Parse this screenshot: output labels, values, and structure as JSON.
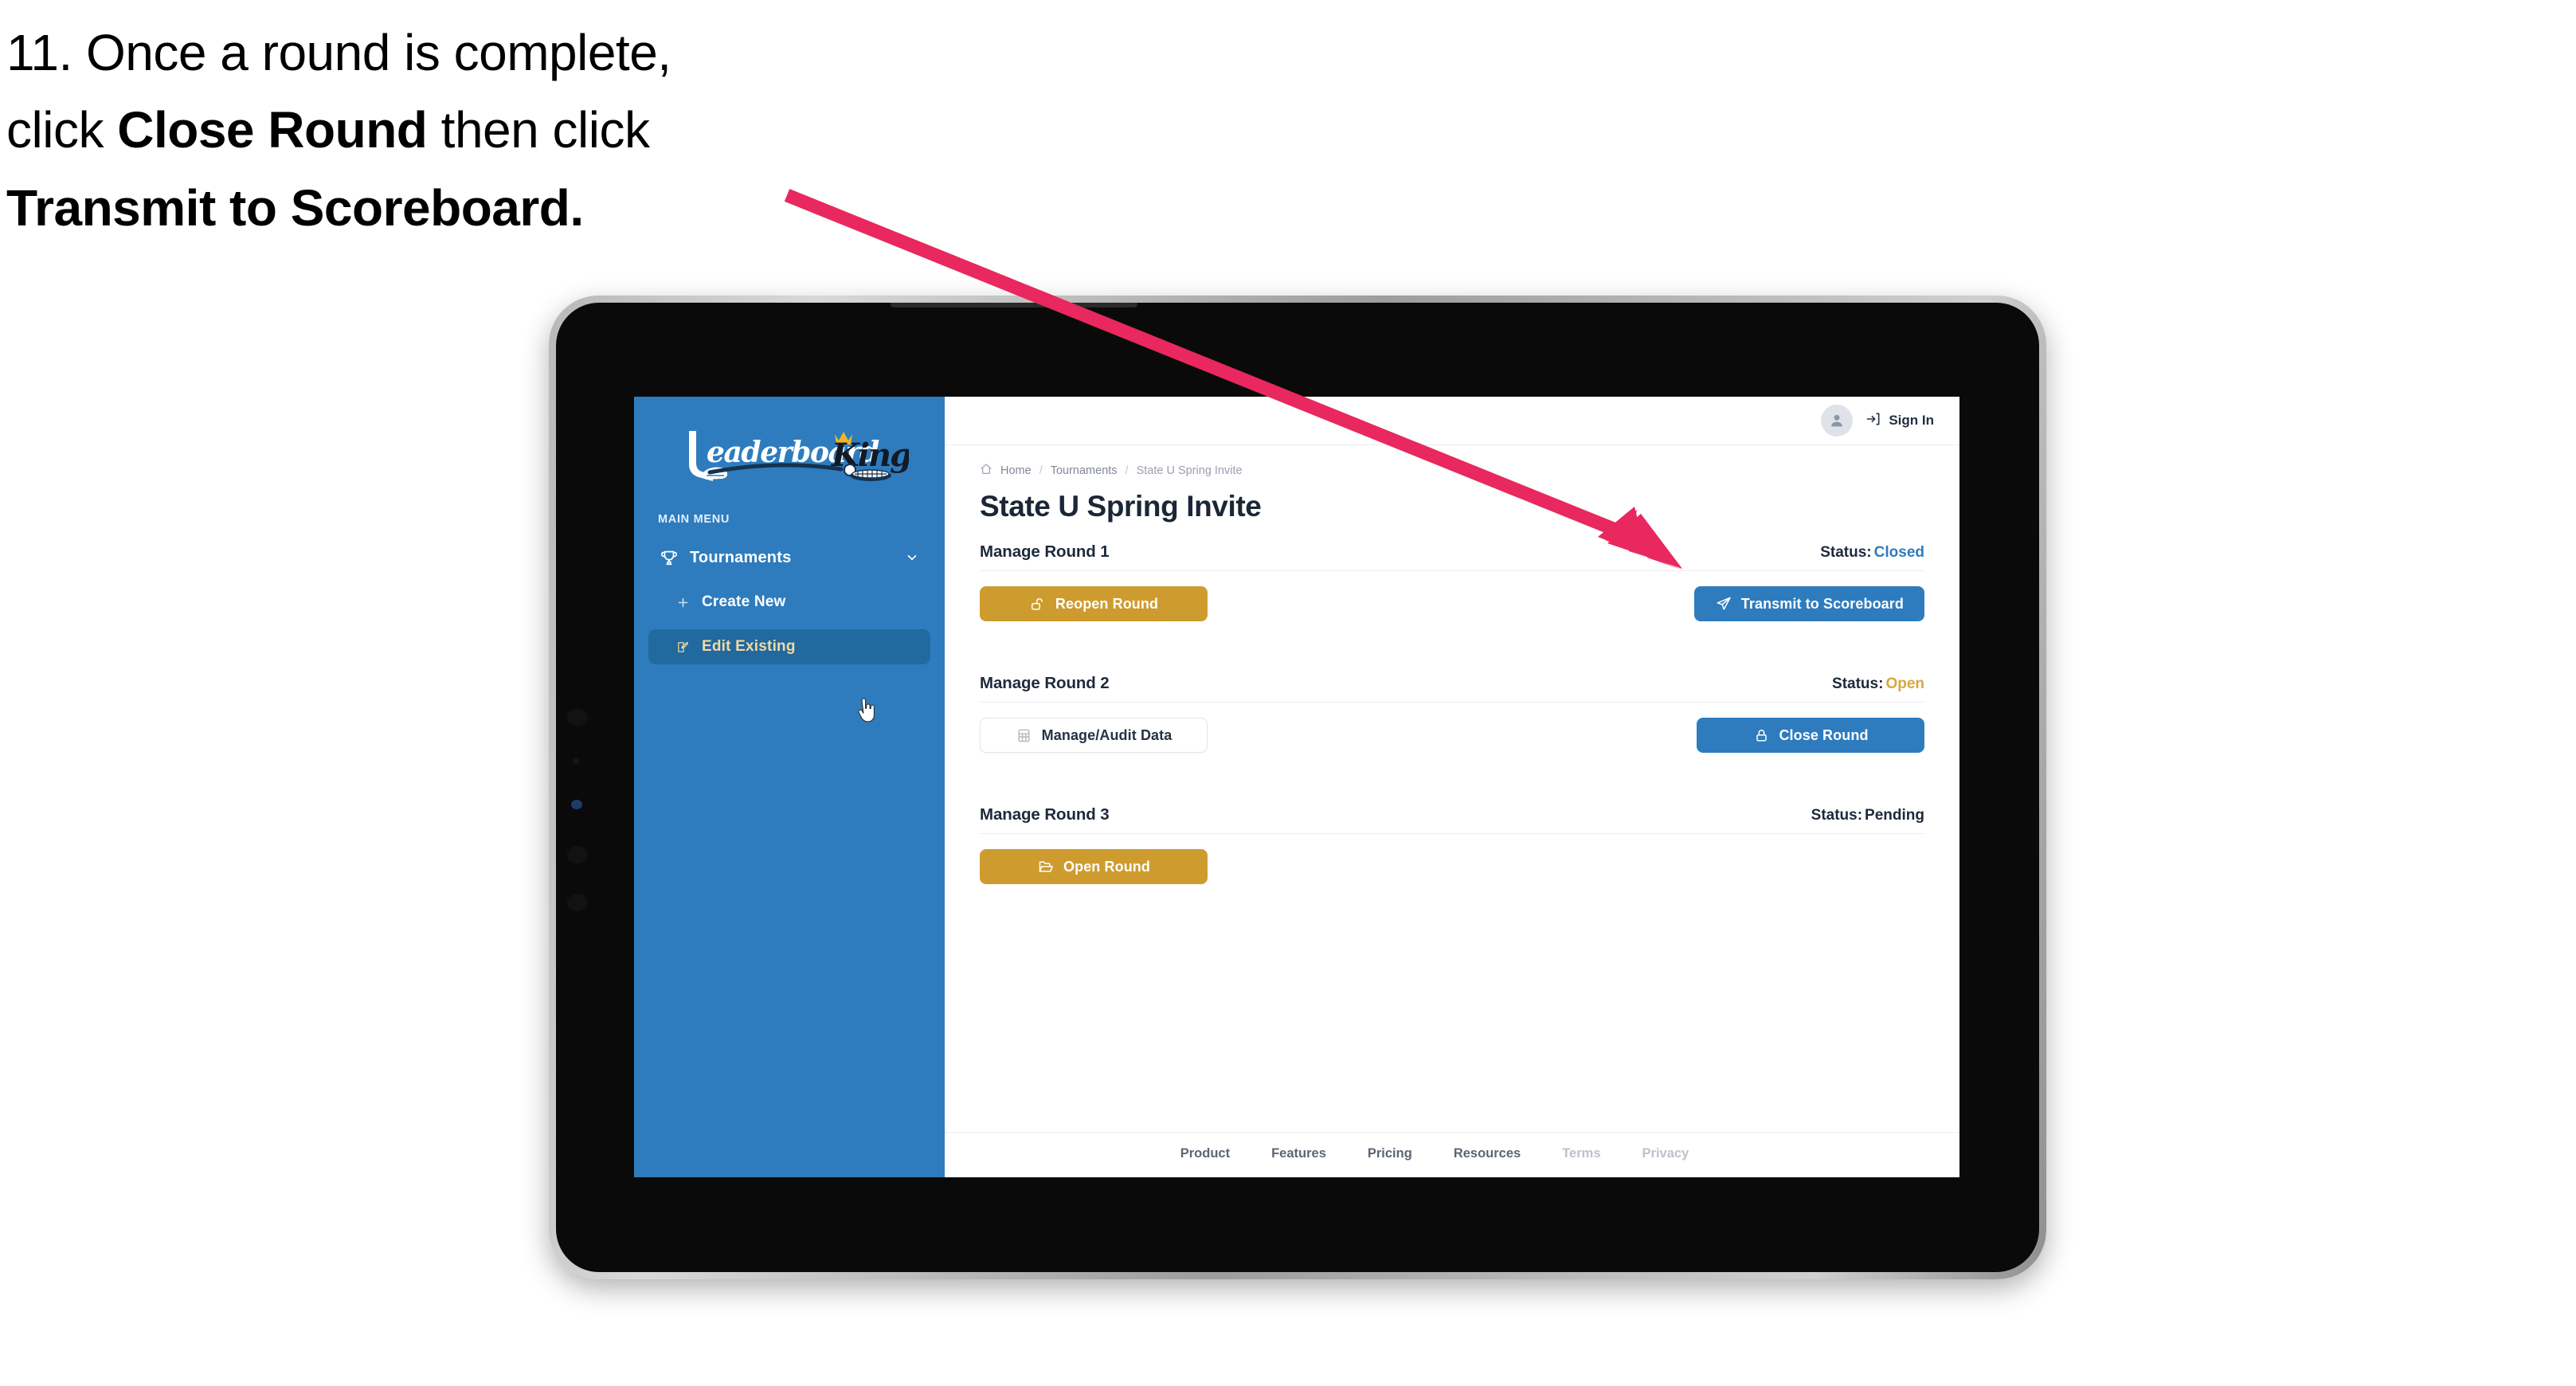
{
  "caption": {
    "line1_plain": "11. Once a round is complete,",
    "line2_pre": "click ",
    "line2_bold": "Close Round",
    "line2_post": " then click",
    "line3_bold": "Transmit to Scoreboard."
  },
  "colors": {
    "brand_blue": "#2E7CBE",
    "brand_blue_dark": "#21699F",
    "gold": "#CE9B2E",
    "status_open_gold": "#D9A640",
    "arrow_pink": "#E8285E",
    "sidebar_active_text": "#F2D9A0",
    "text_dark": "#1e293b"
  },
  "sidebar": {
    "logo": {
      "name": "leaderboardking-logo",
      "word_one": "Leaderboard",
      "word_two": "King"
    },
    "section_label": "MAIN MENU",
    "nav": {
      "label": "Tournaments",
      "icon": "trophy-icon",
      "chevron": "chevron-down-icon"
    },
    "sub_items": [
      {
        "label": "Create New",
        "icon": "plus-icon",
        "active": false
      },
      {
        "label": "Edit Existing",
        "icon": "edit-square-icon",
        "active": true
      }
    ],
    "cursor": "pointer-hand-cursor"
  },
  "topbar": {
    "avatar_icon": "user-avatar-icon",
    "signin_icon": "sign-in-arrow-icon",
    "signin_label": "Sign In"
  },
  "breadcrumb": {
    "home_icon": "home-icon",
    "items": [
      "Home",
      "Tournaments",
      "State U Spring Invite"
    ],
    "separator": "/"
  },
  "page": {
    "title": "State U Spring Invite"
  },
  "rounds": [
    {
      "title": "Manage Round 1",
      "status_label": "Status:",
      "status_value": "Closed",
      "status_class": "closed",
      "left_button": {
        "label": "Reopen Round",
        "icon": "unlock-icon",
        "style": "gold"
      },
      "right_button": {
        "label": "Transmit to Scoreboard",
        "icon": "paper-plane-icon",
        "style": "blue"
      }
    },
    {
      "title": "Manage Round 2",
      "status_label": "Status:",
      "status_value": "Open",
      "status_class": "open",
      "left_button": {
        "label": "Manage/Audit Data",
        "icon": "table-grid-icon",
        "style": "ghost"
      },
      "right_button": {
        "label": "Close Round",
        "icon": "lock-icon",
        "style": "blue"
      }
    },
    {
      "title": "Manage Round 3",
      "status_label": "Status:",
      "status_value": "Pending",
      "status_class": "pending",
      "left_button": {
        "label": "Open Round",
        "icon": "open-folder-icon",
        "style": "gold"
      },
      "right_button": null
    }
  ],
  "footer": {
    "links": [
      {
        "label": "Product",
        "muted": false
      },
      {
        "label": "Features",
        "muted": false
      },
      {
        "label": "Pricing",
        "muted": false
      },
      {
        "label": "Resources",
        "muted": false
      },
      {
        "label": "Terms",
        "muted": true
      },
      {
        "label": "Privacy",
        "muted": true
      }
    ]
  }
}
